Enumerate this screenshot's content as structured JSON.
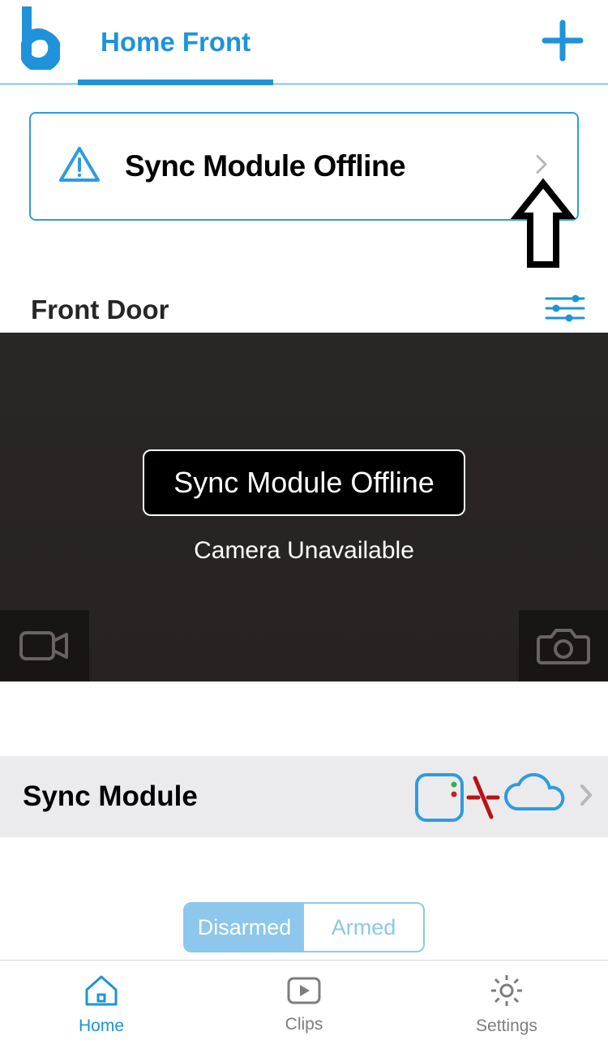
{
  "header": {
    "tab_label": "Home Front"
  },
  "banner": {
    "text": "Sync Module Offline"
  },
  "camera": {
    "name": "Front Door",
    "offline_label": "Sync Module Offline",
    "unavailable_label": "Camera Unavailable"
  },
  "sync_row": {
    "label": "Sync Module"
  },
  "toggle": {
    "options": [
      "Disarmed",
      "Armed"
    ],
    "active_index": 0
  },
  "tabbar": {
    "items": [
      {
        "label": "Home",
        "active": true
      },
      {
        "label": "Clips",
        "active": false
      },
      {
        "label": "Settings",
        "active": false
      }
    ]
  },
  "colors": {
    "accent": "#1e93da",
    "accent_light": "#8dc7eb"
  }
}
